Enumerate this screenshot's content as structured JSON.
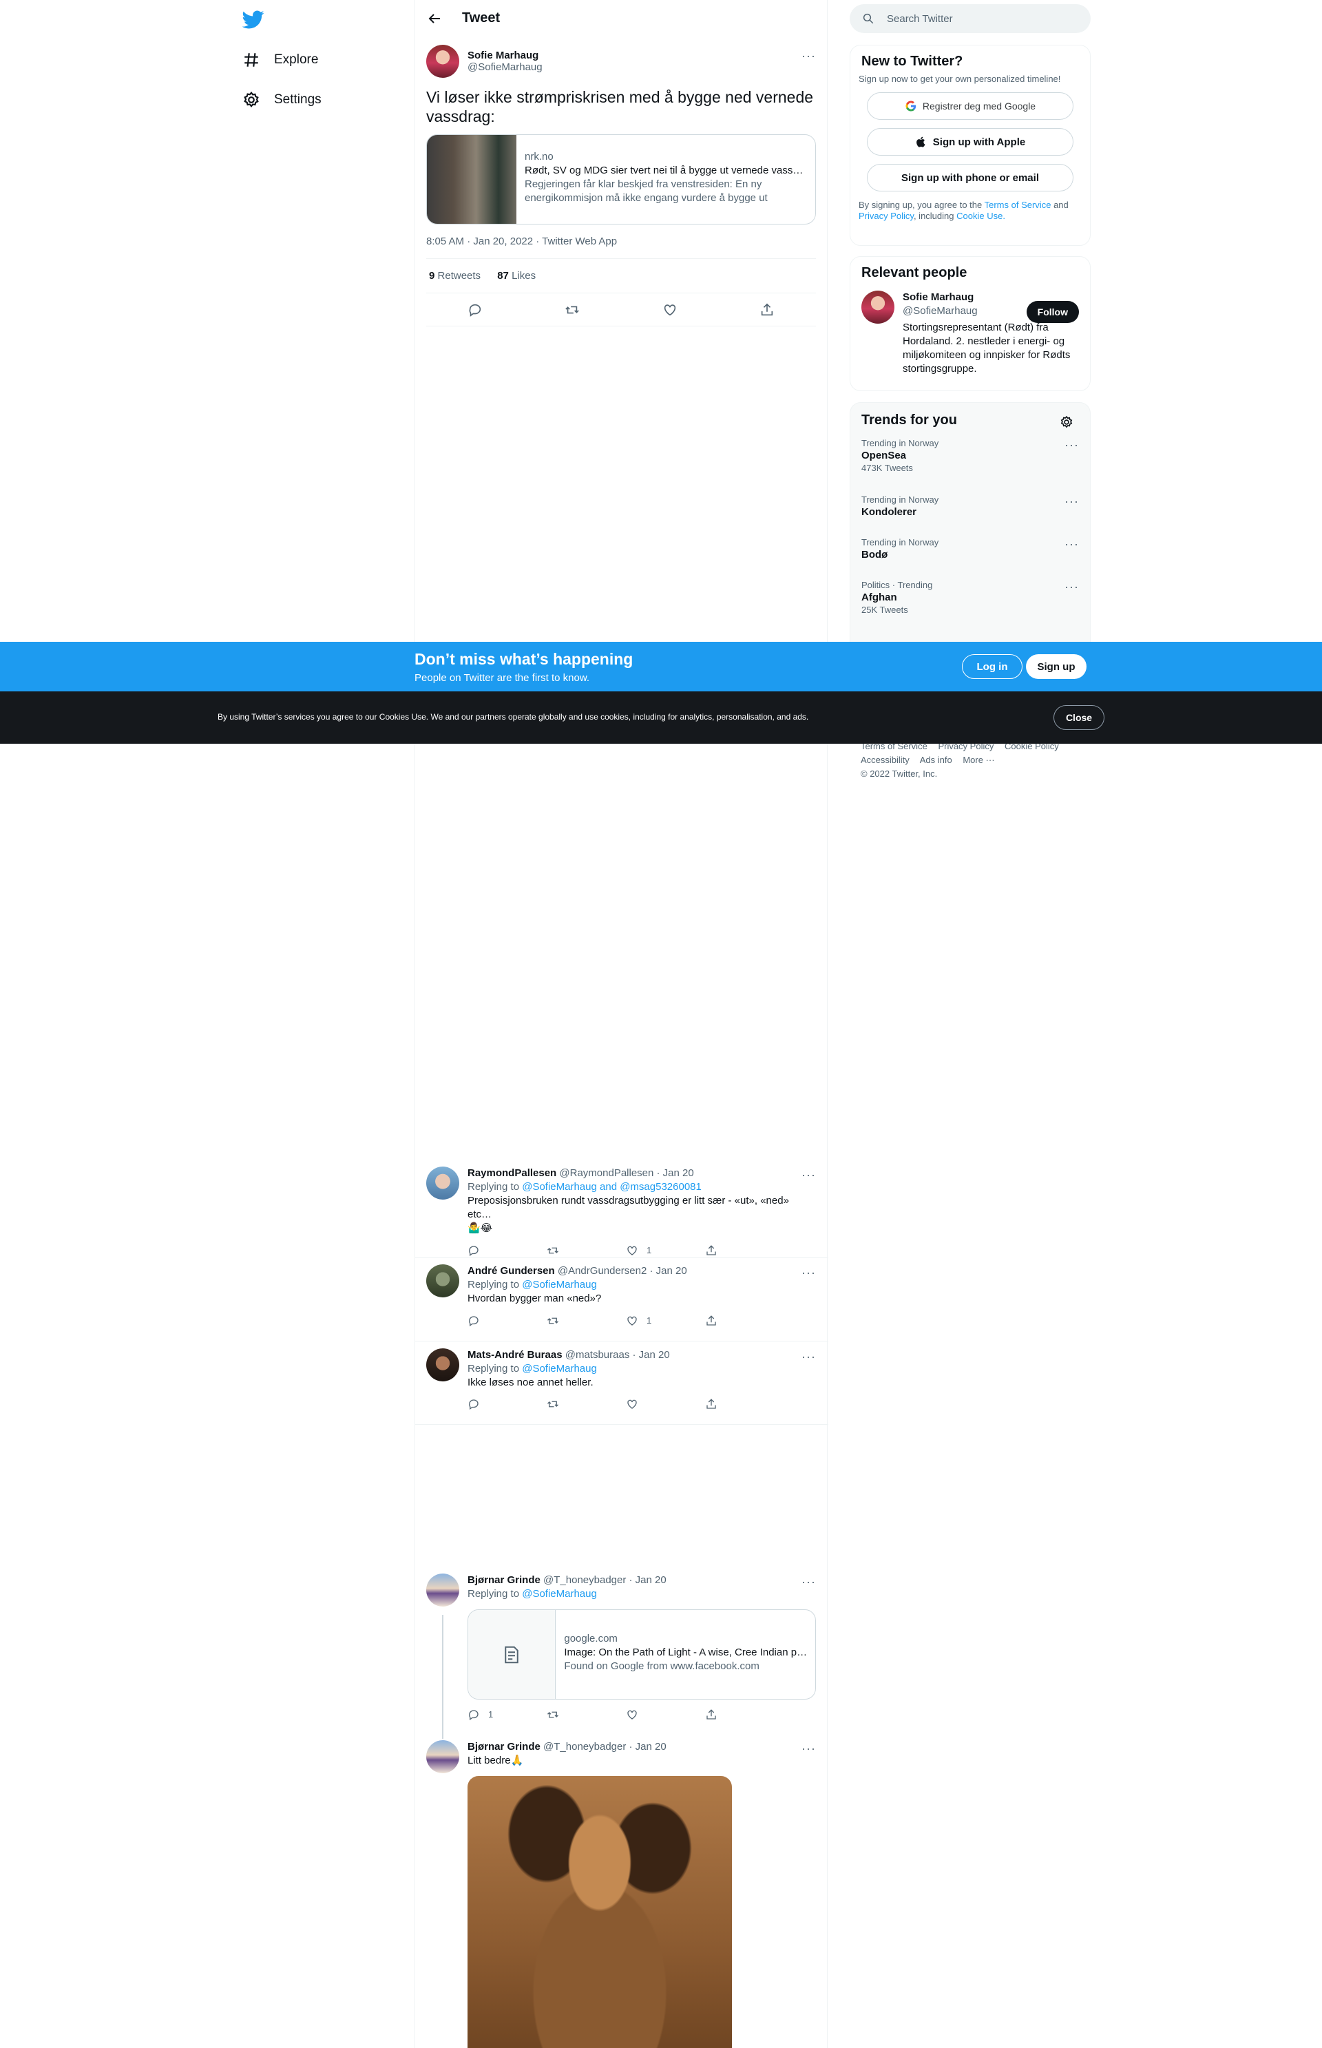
{
  "nav": {
    "explore": "Explore",
    "settings": "Settings"
  },
  "header": {
    "title": "Tweet"
  },
  "main_tweet": {
    "name": "Sofie Marhaug",
    "handle": "@SofieMarhaug",
    "text": "Vi løser ikke strømpriskrisen med å bygge ned vernede vassdrag:",
    "card": {
      "domain": "nrk.no",
      "title": "Rødt, SV og MDG sier tvert nei til å bygge ut vernede vassdrag",
      "description": "Regjeringen får klar beskjed fra venstresiden: En ny energikommisjon må ikke engang vurdere å bygge ut vernede vassdrag."
    },
    "meta": "8:05 AM · Jan 20, 2022 · Twitter Web App",
    "retweets": "9",
    "retweets_label": "Retweets",
    "likes": "87",
    "likes_label": "Likes"
  },
  "replies": [
    {
      "name": "RaymondPallesen",
      "handle_date": "@RaymondPallesen · Jan 20",
      "replying_prefix": "Replying to",
      "replying_to": "@SofieMarhaug and @msag53260081",
      "text": "Preposisjonsbruken rundt vassdragsutbygging er litt sær - «ut», «ned» etc…",
      "emoji": "🤷‍♂️😂",
      "likes": "1"
    },
    {
      "name": "André Gundersen",
      "handle_date": "@AndrGundersen2 · Jan 20",
      "replying_prefix": "Replying to",
      "replying_to": "@SofieMarhaug",
      "text": "Hvordan bygger man «ned»?",
      "likes": "1"
    },
    {
      "name": "Mats-André Buraas",
      "handle_date": "@matsburaas · Jan 20",
      "replying_prefix": "Replying to",
      "replying_to": "@SofieMarhaug",
      "text": "Ikke løses noe annet heller."
    },
    {
      "name": "Bjørnar Grinde",
      "handle_date": "@T_honeybadger · Jan 20",
      "replying_prefix": "Replying to",
      "replying_to": "@SofieMarhaug",
      "card": {
        "domain": "google.com",
        "title": "Image: On the Path of Light - A wise, Cree Indian poem",
        "description": "Found on Google from www.facebook.com"
      },
      "replies": "1"
    },
    {
      "name": "Bjørnar Grinde",
      "handle_date": "@T_honeybadger · Jan 20",
      "text": "Litt bedre🙏"
    }
  ],
  "right": {
    "search_placeholder": "Search Twitter",
    "new": {
      "title": "New to Twitter?",
      "subtitle": "Sign up now to get your own personalized timeline!",
      "google": "Registrer deg med Google",
      "apple": "Sign up with Apple",
      "phone": "Sign up with phone or email",
      "terms_prefix": "By signing up, you agree to the",
      "terms_link": "Terms of Service",
      "terms_and": "and",
      "privacy_link": "Privacy Policy",
      "including": ", including",
      "cookie_link": "Cookie Use."
    },
    "relevant": {
      "title": "Relevant people",
      "name": "Sofie Marhaug",
      "handle": "@SofieMarhaug",
      "follow": "Follow",
      "bio": "Stortingsrepresentant (Rødt) fra Hordaland. 2. nestleder i energi- og miljøkomiteen og innpisker for Rødts stortingsgruppe."
    },
    "trends": {
      "title": "Trends for you",
      "items": [
        {
          "context": "Trending in Norway",
          "name": "OpenSea",
          "count": "473K Tweets"
        },
        {
          "context": "Trending in Norway",
          "name": "Kondolerer",
          "count": ""
        },
        {
          "context": "Trending in Norway",
          "name": "Bodø",
          "count": ""
        },
        {
          "context": "Politics · Trending",
          "name": "Afghan",
          "count": "25K Tweets"
        }
      ]
    },
    "footer": {
      "terms": "Terms of Service",
      "privacy": "Privacy Policy",
      "cookie": "Cookie Policy",
      "accessibility": "Accessibility",
      "ads": "Ads info",
      "more": "More ···",
      "copyright": "© 2022 Twitter, Inc."
    }
  },
  "banner": {
    "title": "Don’t miss what’s happening",
    "subtitle": "People on Twitter are the first to know.",
    "login": "Log in",
    "signup": "Sign up"
  },
  "cookie": {
    "text": "By using Twitter’s services you agree to our Cookies Use. We and our partners operate globally and use cookies, including for analytics, personalisation, and ads.",
    "close": "Close"
  },
  "colors": {
    "accent": "#1d9bf0",
    "text": "#0f1419",
    "muted": "#536471",
    "cookie_bg": "#15181c"
  }
}
